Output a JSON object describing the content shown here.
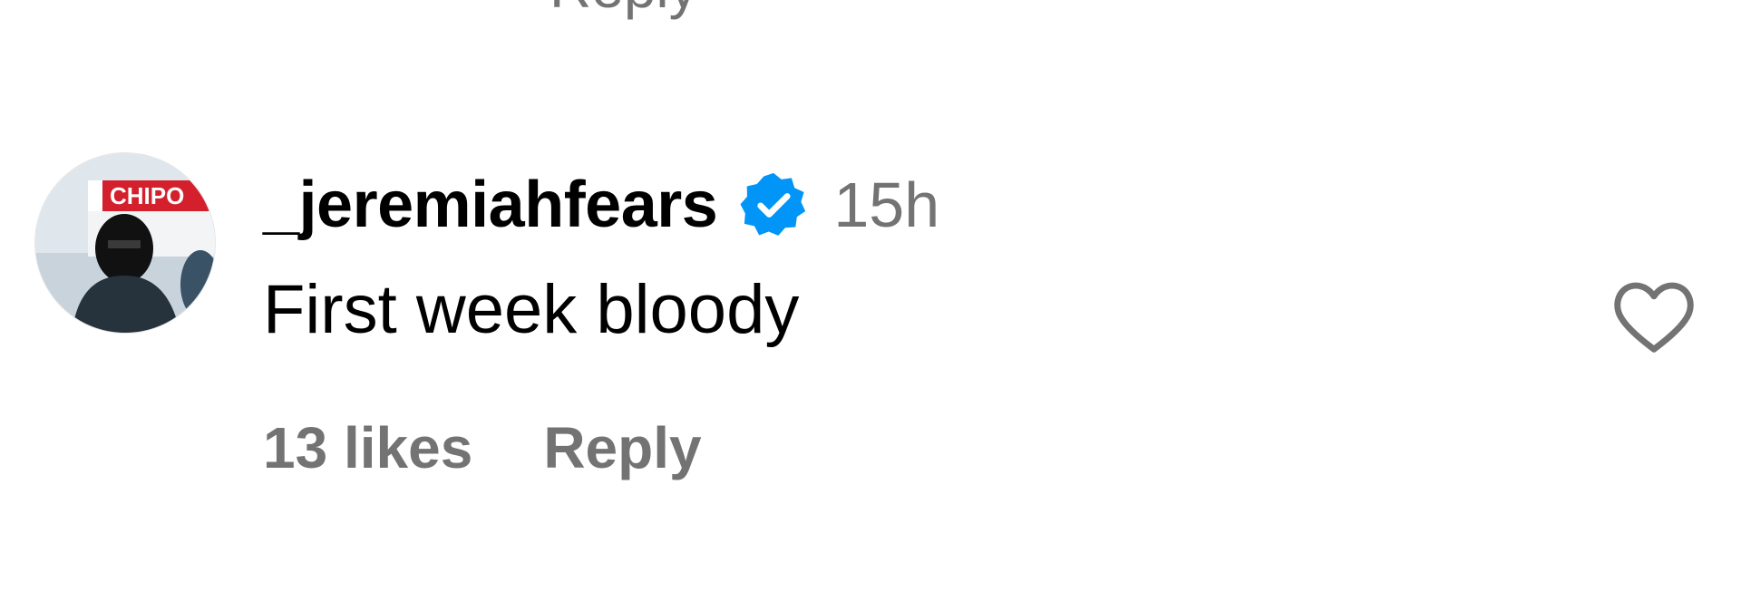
{
  "previous_comment": {
    "reply_label": "Reply"
  },
  "comment": {
    "avatar": {
      "description_icon": "profile-picture",
      "sign_text": "CHIPO"
    },
    "username": "_jeremiahfears",
    "verified": true,
    "timestamp": "15h",
    "text": "First week bloody",
    "likes": "13 likes",
    "reply_label": "Reply",
    "like_icon": "heart-outline-icon"
  },
  "colors": {
    "text_primary": "#000000",
    "text_secondary": "#737373",
    "verified_blue": "#0095f6",
    "background": "#ffffff"
  }
}
